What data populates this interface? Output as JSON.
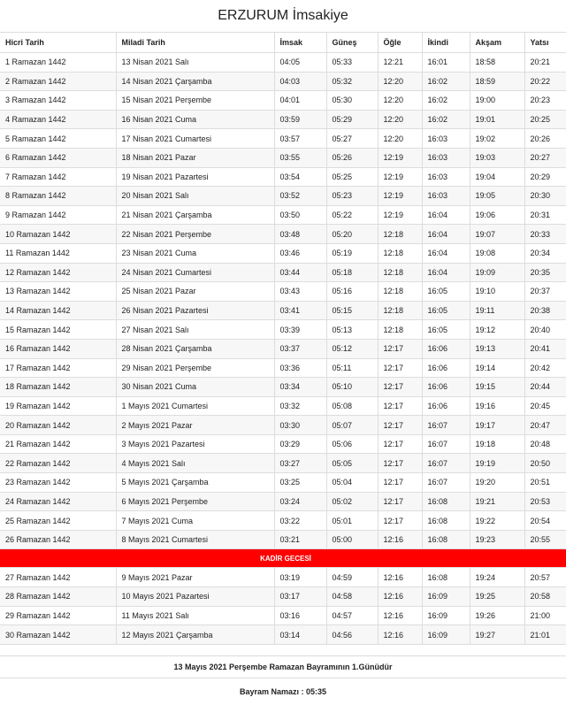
{
  "title": "ERZURUM İmsakiye",
  "headers": [
    "Hicri Tarih",
    "Miladi Tarih",
    "İmsak",
    "Güneş",
    "Öğle",
    "İkindi",
    "Akşam",
    "Yatsı"
  ],
  "rows": [
    [
      "1 Ramazan 1442",
      "13 Nisan 2021 Salı",
      "04:05",
      "05:33",
      "12:21",
      "16:01",
      "18:58",
      "20:21"
    ],
    [
      "2 Ramazan 1442",
      "14 Nisan 2021 Çarşamba",
      "04:03",
      "05:32",
      "12:20",
      "16:02",
      "18:59",
      "20:22"
    ],
    [
      "3 Ramazan 1442",
      "15 Nisan 2021 Perşembe",
      "04:01",
      "05:30",
      "12:20",
      "16:02",
      "19:00",
      "20:23"
    ],
    [
      "4 Ramazan 1442",
      "16 Nisan 2021 Cuma",
      "03:59",
      "05:29",
      "12:20",
      "16:02",
      "19:01",
      "20:25"
    ],
    [
      "5 Ramazan 1442",
      "17 Nisan 2021 Cumartesi",
      "03:57",
      "05:27",
      "12:20",
      "16:03",
      "19:02",
      "20:26"
    ],
    [
      "6 Ramazan 1442",
      "18 Nisan 2021 Pazar",
      "03:55",
      "05:26",
      "12:19",
      "16:03",
      "19:03",
      "20:27"
    ],
    [
      "7 Ramazan 1442",
      "19 Nisan 2021 Pazartesi",
      "03:54",
      "05:25",
      "12:19",
      "16:03",
      "19:04",
      "20:29"
    ],
    [
      "8 Ramazan 1442",
      "20 Nisan 2021 Salı",
      "03:52",
      "05:23",
      "12:19",
      "16:03",
      "19:05",
      "20:30"
    ],
    [
      "9 Ramazan 1442",
      "21 Nisan 2021 Çarşamba",
      "03:50",
      "05:22",
      "12:19",
      "16:04",
      "19:06",
      "20:31"
    ],
    [
      "10 Ramazan 1442",
      "22 Nisan 2021 Perşembe",
      "03:48",
      "05:20",
      "12:18",
      "16:04",
      "19:07",
      "20:33"
    ],
    [
      "11 Ramazan 1442",
      "23 Nisan 2021 Cuma",
      "03:46",
      "05:19",
      "12:18",
      "16:04",
      "19:08",
      "20:34"
    ],
    [
      "12 Ramazan 1442",
      "24 Nisan 2021 Cumartesi",
      "03:44",
      "05:18",
      "12:18",
      "16:04",
      "19:09",
      "20:35"
    ],
    [
      "13 Ramazan 1442",
      "25 Nisan 2021 Pazar",
      "03:43",
      "05:16",
      "12:18",
      "16:05",
      "19:10",
      "20:37"
    ],
    [
      "14 Ramazan 1442",
      "26 Nisan 2021 Pazartesi",
      "03:41",
      "05:15",
      "12:18",
      "16:05",
      "19:11",
      "20:38"
    ],
    [
      "15 Ramazan 1442",
      "27 Nisan 2021 Salı",
      "03:39",
      "05:13",
      "12:18",
      "16:05",
      "19:12",
      "20:40"
    ],
    [
      "16 Ramazan 1442",
      "28 Nisan 2021 Çarşamba",
      "03:37",
      "05:12",
      "12:17",
      "16:06",
      "19:13",
      "20:41"
    ],
    [
      "17 Ramazan 1442",
      "29 Nisan 2021 Perşembe",
      "03:36",
      "05:11",
      "12:17",
      "16:06",
      "19:14",
      "20:42"
    ],
    [
      "18 Ramazan 1442",
      "30 Nisan 2021 Cuma",
      "03:34",
      "05:10",
      "12:17",
      "16:06",
      "19:15",
      "20:44"
    ],
    [
      "19 Ramazan 1442",
      "1 Mayıs 2021 Cumartesi",
      "03:32",
      "05:08",
      "12:17",
      "16:06",
      "19:16",
      "20:45"
    ],
    [
      "20 Ramazan 1442",
      "2 Mayıs 2021 Pazar",
      "03:30",
      "05:07",
      "12:17",
      "16:07",
      "19:17",
      "20:47"
    ],
    [
      "21 Ramazan 1442",
      "3 Mayıs 2021 Pazartesi",
      "03:29",
      "05:06",
      "12:17",
      "16:07",
      "19:18",
      "20:48"
    ],
    [
      "22 Ramazan 1442",
      "4 Mayıs 2021 Salı",
      "03:27",
      "05:05",
      "12:17",
      "16:07",
      "19:19",
      "20:50"
    ],
    [
      "23 Ramazan 1442",
      "5 Mayıs 2021 Çarşamba",
      "03:25",
      "05:04",
      "12:17",
      "16:07",
      "19:20",
      "20:51"
    ],
    [
      "24 Ramazan 1442",
      "6 Mayıs 2021 Perşembe",
      "03:24",
      "05:02",
      "12:17",
      "16:08",
      "19:21",
      "20:53"
    ],
    [
      "25 Ramazan 1442",
      "7 Mayıs 2021 Cuma",
      "03:22",
      "05:01",
      "12:17",
      "16:08",
      "19:22",
      "20:54"
    ],
    [
      "26 Ramazan 1442",
      "8 Mayıs 2021 Cumartesi",
      "03:21",
      "05:00",
      "12:16",
      "16:08",
      "19:23",
      "20:55"
    ]
  ],
  "kadir_label": "KADİR GECESİ",
  "rows_after": [
    [
      "27 Ramazan 1442",
      "9 Mayıs 2021 Pazar",
      "03:19",
      "04:59",
      "12:16",
      "16:08",
      "19:24",
      "20:57"
    ],
    [
      "28 Ramazan 1442",
      "10 Mayıs 2021 Pazartesi",
      "03:17",
      "04:58",
      "12:16",
      "16:09",
      "19:25",
      "20:58"
    ],
    [
      "29 Ramazan 1442",
      "11 Mayıs 2021 Salı",
      "03:16",
      "04:57",
      "12:16",
      "16:09",
      "19:26",
      "21:00"
    ],
    [
      "30 Ramazan 1442",
      "12 Mayıs 2021 Çarşamba",
      "03:14",
      "04:56",
      "12:16",
      "16:09",
      "19:27",
      "21:01"
    ]
  ],
  "footer": {
    "bayram": "13 Mayıs 2021 Perşembe Ramazan Bayramının 1.Günüdür",
    "namaz": "Bayram Namazı : 05:35"
  },
  "colors": {
    "kadir_bg": "#ff0000",
    "border": "#dddddd",
    "stripe": "#f7f7f7"
  }
}
